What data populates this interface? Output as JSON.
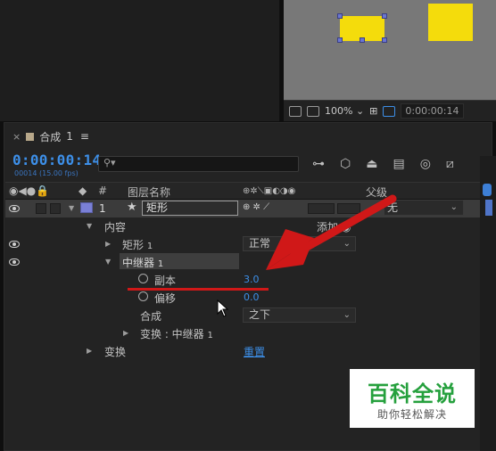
{
  "viewer": {
    "zoom": "100%",
    "timecode": "0:00:00:14"
  },
  "composition": {
    "tab_name": "合成",
    "tab_number": "1",
    "menu_glyph": "≡",
    "close_glyph": "×",
    "timecode": "0:00:00:14",
    "fps": "00014 (15.00 fps)",
    "search_glyph": "⚲▾"
  },
  "columns": {
    "hash": "#",
    "layer_name": "图层名称",
    "parent": "父级"
  },
  "layer": {
    "number": "1",
    "name": "矩形",
    "parent_value": "无"
  },
  "properties": {
    "contents": "内容",
    "add_label": "添加",
    "rect_group": "矩形",
    "rect_group_num": "1",
    "rect_mode": "正常",
    "repeater": "中继器",
    "repeater_num": "1",
    "copies_label": "副本",
    "copies_value": "3.0",
    "offset_label": "偏移",
    "offset_value": "0.0",
    "composite_label": "合成",
    "composite_value": "之下",
    "transform_repeater": "变换 : 中继器",
    "transform_repeater_num": "1",
    "transform": "变换",
    "reset": "重置"
  },
  "watermark": {
    "title": "百科全说",
    "subtitle": "助你轻松解决"
  },
  "colors": {
    "accent_blue": "#3d8fe8",
    "shape_yellow": "#f4dc0c",
    "annotation_red": "#d01818",
    "label_purple": "#7a80d6",
    "watermark_green": "#25a03d"
  }
}
